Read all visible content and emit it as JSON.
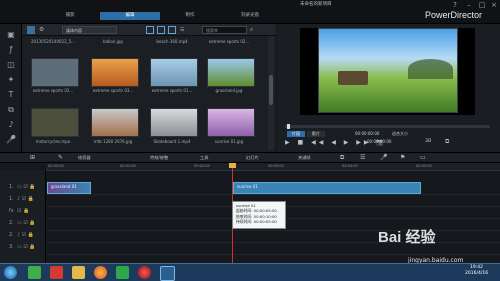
{
  "app": {
    "title": "未命名的新项目",
    "brand": "PowerDirector",
    "menu": [
      "捕获",
      "编辑",
      "制作",
      "刻录光盘"
    ],
    "active_menu_index": 1
  },
  "library": {
    "filter_label": "媒体内容",
    "search_placeholder": "搜索库",
    "top_row_labels": [
      "20130520140022_5...",
      "ballon.jpg",
      "beach 360.mp4",
      "extreme sports 02..."
    ],
    "items": [
      {
        "label": "extreme sports 02...",
        "color": "#5d6d7a"
      },
      {
        "label": "extreme sports 03...",
        "color": "#c9722f"
      },
      {
        "label": "extreme sports 01...",
        "color": "#7fa8c6"
      },
      {
        "label": "grassland.jpg",
        "color": "#6e9b3f"
      },
      {
        "label": "motorcycles.mpo",
        "color": "#4b4f3c"
      },
      {
        "label": "mtb 1280 2676.jpg",
        "color": "#a26f4a"
      },
      {
        "label": "Skateboard 1.mp4",
        "color": "#8b8f93"
      },
      {
        "label": "sunrise 01.jpg",
        "color": "#b58ac6"
      }
    ]
  },
  "preview": {
    "mode_clip": "片段",
    "mode_movie": "影片",
    "timecode1": "00:00:00:00",
    "timecode2": "00:00:00:00",
    "fit_label": "适合大小",
    "d3": "3D"
  },
  "toolbar": {
    "items": [
      "修剪器",
      "特效/修整",
      "工具",
      "幻灯片",
      "关键帧"
    ]
  },
  "timeline": {
    "ruler_marks": [
      "00:00:00",
      "00:01:00",
      "00:02:00",
      "00:03:00",
      "00:04:00",
      "00:05:00"
    ],
    "tracks": [
      "1.",
      "1.",
      "fx",
      "2.",
      "2.",
      "3.",
      "3."
    ],
    "clip1_label": "grassland 01",
    "clip2_label": "sunrise 01",
    "tooltip": {
      "line1": "sunrise 01",
      "line2": "起始时间: 00:00:05:00",
      "line3": "结束时间: 00:00:10:00",
      "line4": "持续时间: 00:00:05:00"
    }
  },
  "taskbar": {
    "time": "19:42",
    "date": "2016/4/16"
  },
  "watermark": {
    "brand": "Bai 经验",
    "url": "jingyan.baidu.com"
  }
}
